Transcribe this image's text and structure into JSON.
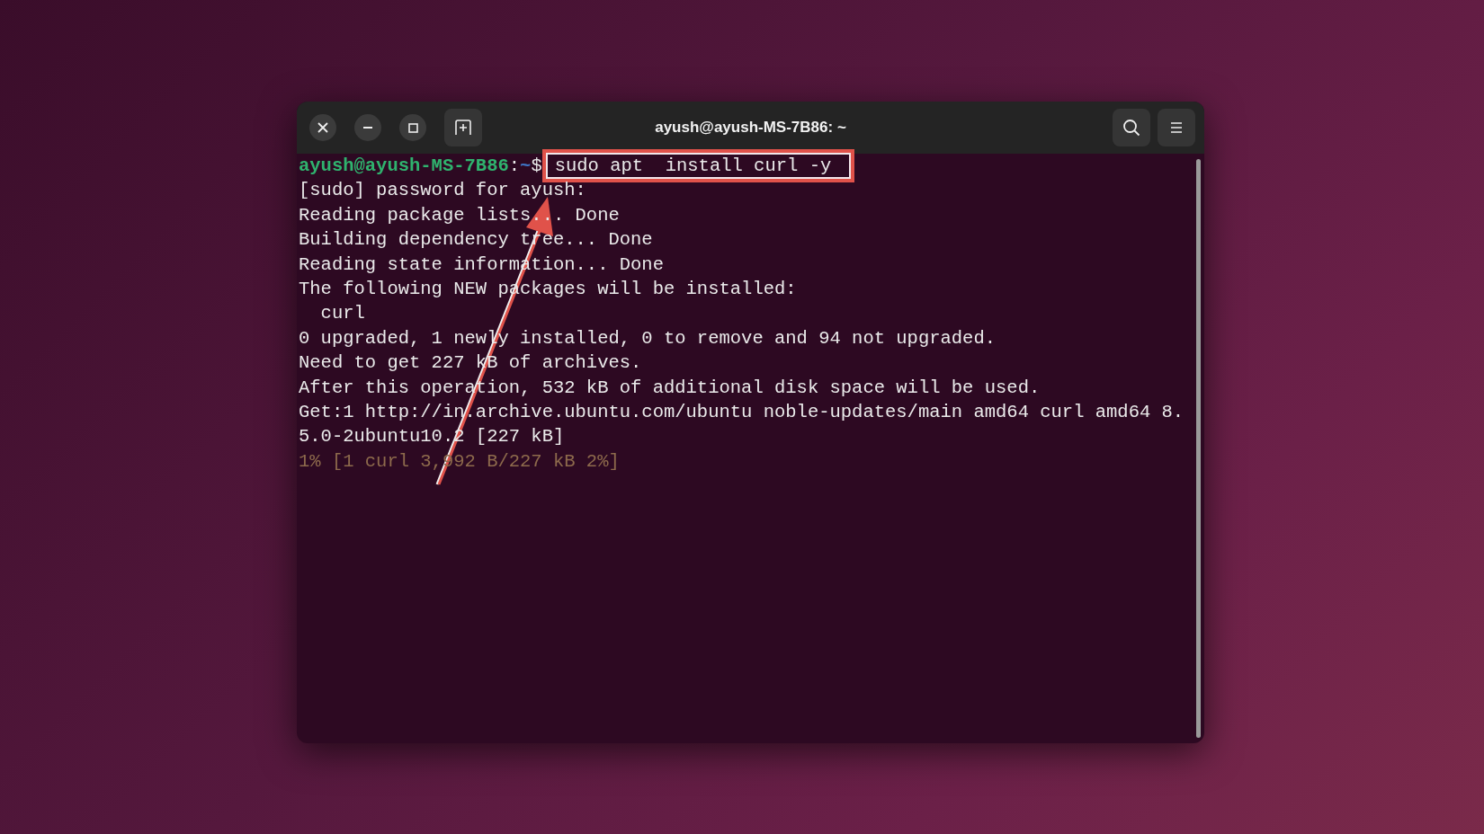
{
  "window": {
    "title": "ayush@ayush-MS-7B86: ~"
  },
  "lines": [
    {
      "kind": "prompt",
      "user_host": "ayush@ayush-MS-7B86",
      "separator": ":",
      "path": "~",
      "symbol": "$",
      "command": "sudo apt  install curl -y",
      "highlighted": true
    },
    {
      "kind": "output",
      "text": "[sudo] password for ayush:"
    },
    {
      "kind": "output",
      "text": "Reading package lists... Done"
    },
    {
      "kind": "output",
      "text": "Building dependency tree... Done"
    },
    {
      "kind": "output",
      "text": "Reading state information... Done"
    },
    {
      "kind": "output",
      "text": "The following NEW packages will be installed:"
    },
    {
      "kind": "output",
      "text": "  curl"
    },
    {
      "kind": "output",
      "text": "0 upgraded, 1 newly installed, 0 to remove and 94 not upgraded."
    },
    {
      "kind": "output",
      "text": "Need to get 227 kB of archives."
    },
    {
      "kind": "output",
      "text": "After this operation, 532 kB of additional disk space will be used."
    },
    {
      "kind": "output",
      "text": "Get:1 http://in.archive.ubuntu.com/ubuntu noble-updates/main amd64 curl amd64 8."
    },
    {
      "kind": "output",
      "text": "5.0-2ubuntu10.2 [227 kB]"
    },
    {
      "kind": "progress",
      "text": "1% [1 curl 3,992 B/227 kB 2%]"
    }
  ],
  "annotations": [
    {
      "kind": "arrow"
    }
  ]
}
